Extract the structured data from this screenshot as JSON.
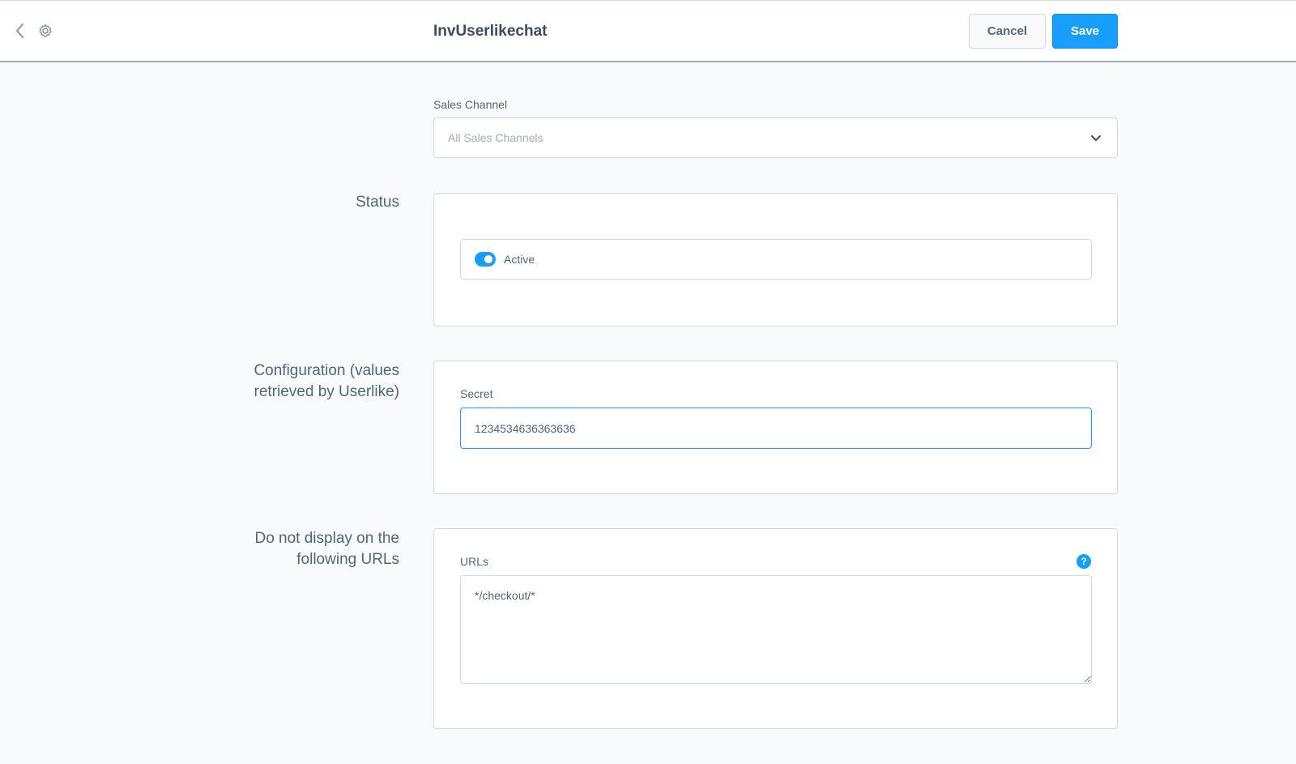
{
  "header": {
    "title": "InvUserlikechat",
    "cancel_label": "Cancel",
    "save_label": "Save",
    "back_icon": "chevron-left-icon",
    "settings_icon": "gear-icon"
  },
  "sales_channel": {
    "label": "Sales Channel",
    "selected": "All Sales Channels"
  },
  "status": {
    "section_label": "Status",
    "toggle_label": "Active",
    "active": true
  },
  "configuration": {
    "section_label_line1": "Configuration (values",
    "section_label_line2": "retrieved by Userlike)",
    "secret_label": "Secret",
    "secret_value": "1234534636363636"
  },
  "exclude_urls": {
    "section_label_line1": "Do not display on the",
    "section_label_line2": "following URLs",
    "urls_label": "URLs",
    "urls_value": "*/checkout/*",
    "help_glyph": "?"
  },
  "colors": {
    "accent": "#189eff",
    "text": "#52667a",
    "border": "#d1d9e0",
    "background": "#f9fafb"
  }
}
